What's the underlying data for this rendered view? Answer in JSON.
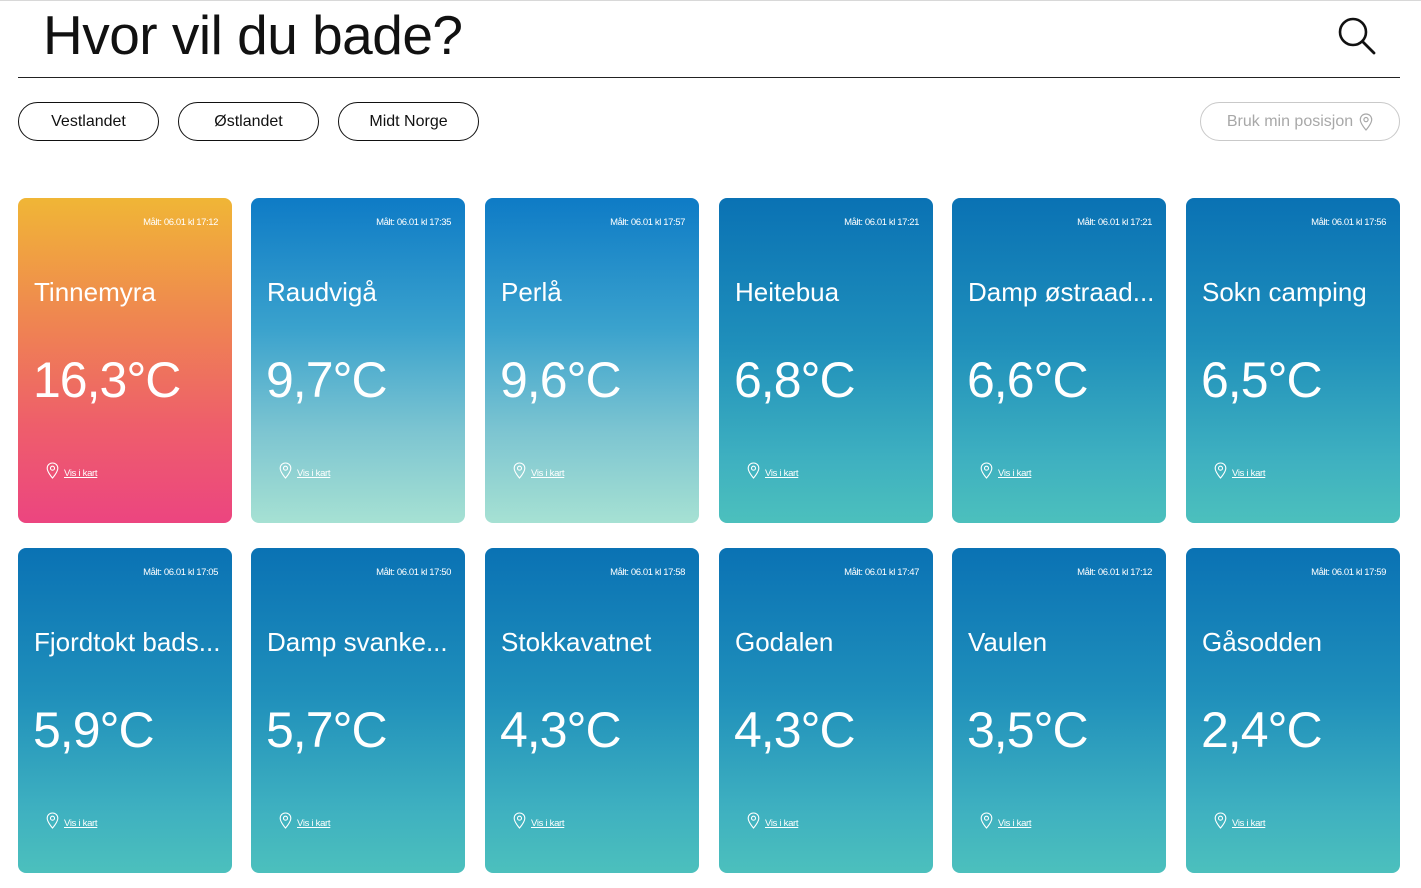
{
  "header": {
    "title": "Hvor vil du bade?",
    "search_icon": "search-icon"
  },
  "filters": {
    "items": [
      "Vestlandet",
      "Østlandet",
      "Midt Norge"
    ],
    "position_button": "Bruk min posisjon",
    "position_icon": "location-pin-icon"
  },
  "colors": {
    "warm_gradient": [
      "#f0b636",
      "#ef8551",
      "#ee5e6b",
      "#ec4580"
    ],
    "cool_gradient": [
      "#0e7bc6",
      "#3aa2cd",
      "#7dc5d1",
      "#a6e1d3"
    ],
    "sea_gradient": [
      "#0a72b4",
      "#1f8fbb",
      "#3eb0c0",
      "#4cc0bd"
    ]
  },
  "cards": [
    {
      "measured": "Målt: 06.01 kl 17:12",
      "name": "Tinnemyra",
      "temp": "16,3°C",
      "map_label": "Vis i kart",
      "style": "warm"
    },
    {
      "measured": "Målt: 06.01 kl 17:35",
      "name": "Raudvigå",
      "temp": "9,7°C",
      "map_label": "Vis i kart",
      "style": "cool"
    },
    {
      "measured": "Målt: 06.01 kl 17:57",
      "name": "Perlå",
      "temp": "9,6°C",
      "map_label": "Vis i kart",
      "style": "cool"
    },
    {
      "measured": "Målt: 06.01 kl 17:21",
      "name": "Heitebua",
      "temp": "6,8°C",
      "map_label": "Vis i kart",
      "style": "sea"
    },
    {
      "measured": "Målt: 06.01 kl 17:21",
      "name": "Damp østraad...",
      "temp": "6,6°C",
      "map_label": "Vis i kart",
      "style": "sea"
    },
    {
      "measured": "Målt: 06.01 kl 17:56",
      "name": "Sokn camping",
      "temp": "6,5°C",
      "map_label": "Vis i kart",
      "style": "sea"
    },
    {
      "measured": "Målt: 06.01 kl 17:05",
      "name": "Fjordtokt bads...",
      "temp": "5,9°C",
      "map_label": "Vis i kart",
      "style": "sea"
    },
    {
      "measured": "Målt: 06.01 kl 17:50",
      "name": "Damp svanke...",
      "temp": "5,7°C",
      "map_label": "Vis i kart",
      "style": "sea"
    },
    {
      "measured": "Målt: 06.01 kl 17:58",
      "name": "Stokkavatnet",
      "temp": "4,3°C",
      "map_label": "Vis i kart",
      "style": "sea"
    },
    {
      "measured": "Målt: 06.01 kl 17:47",
      "name": "Godalen",
      "temp": "4,3°C",
      "map_label": "Vis i kart",
      "style": "sea"
    },
    {
      "measured": "Målt: 06.01 kl 17:12",
      "name": "Vaulen",
      "temp": "3,5°C",
      "map_label": "Vis i kart",
      "style": "sea"
    },
    {
      "measured": "Målt: 06.01 kl 17:59",
      "name": "Gåsodden",
      "temp": "2,4°C",
      "map_label": "Vis i kart",
      "style": "sea"
    }
  ]
}
